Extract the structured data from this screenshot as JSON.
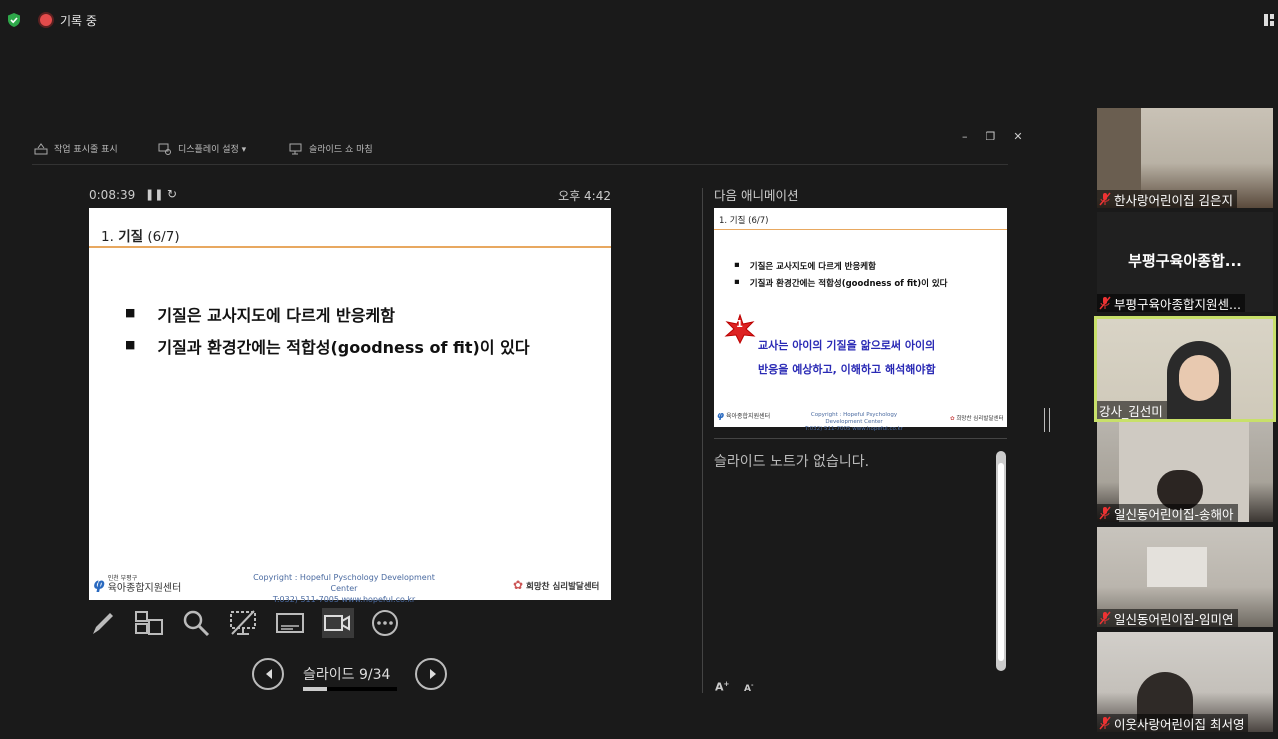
{
  "topbar": {
    "recording_label": "기록 중"
  },
  "toolbar": {
    "show_taskbar": "작업 표시줄 표시",
    "display_settings": "디스플레이 설정 ▾",
    "end_slideshow": "슬라이드 쇼 마침"
  },
  "timer": {
    "elapsed": "0:08:39",
    "clock": "오후 4:42"
  },
  "slide": {
    "title_num": "1.",
    "title_bold": "기질",
    "title_rest": "(6/7)",
    "bullets": [
      "기질은 교사지도에 다르게 반응케함",
      "기질과 환경간에는 적합성(goodness of fit)이 있다"
    ],
    "footer_left_small": "인천 부평구",
    "footer_left": "육아종합지원센터",
    "footer_mid_1": "Copyright : Hopeful Pyschology Development Center",
    "footer_mid_2": "T:032) 511-7005  www.hopeful.co.kr",
    "footer_right": "희망찬 심리발달센터"
  },
  "nav": {
    "counter": "슬라이드 9/34",
    "progress": 0.26
  },
  "next_panel": {
    "label": "다음 애니메이션",
    "title": "1. 기질 (6/7)",
    "bullets": [
      "기질은 교사지도에 다르게 반응케함",
      "기질과 환경간에는 적합성(goodness of fit)이 있다"
    ],
    "star_num": "1",
    "blue_1": "교사는 아이의 기질을 앎으로써 아이의",
    "blue_2": "반응을 예상하고, 이해하고 해석해야함",
    "footer_left": "육아종합지원센터",
    "footer_mid_1": "Copyright : Hopeful Psychology Development Center",
    "footer_mid_2": "T:032) 511-7005  www.hopeful.co.kr",
    "footer_right": "희망찬 심리발달센터"
  },
  "notes": {
    "text": "슬라이드 노트가 없습니다."
  },
  "participants": [
    {
      "name": "한사랑어린이집 김은지",
      "muted": true
    },
    {
      "name": "부평구육아종합지원센...",
      "muted": true,
      "big_label": "부평구육아종합..."
    },
    {
      "name": "강사_김선미",
      "muted": false,
      "active": true
    },
    {
      "name": "일신동어린이집-송해아",
      "muted": true
    },
    {
      "name": "일신동어린이집-임미연",
      "muted": true
    },
    {
      "name": "이웃사랑어린이집 최서영",
      "muted": true
    }
  ],
  "colors": {
    "active_speaker": "#c8e06a",
    "recording": "#e34b4b",
    "slide_rule": "#e8a860",
    "next_blue": "#2a2ab5"
  }
}
